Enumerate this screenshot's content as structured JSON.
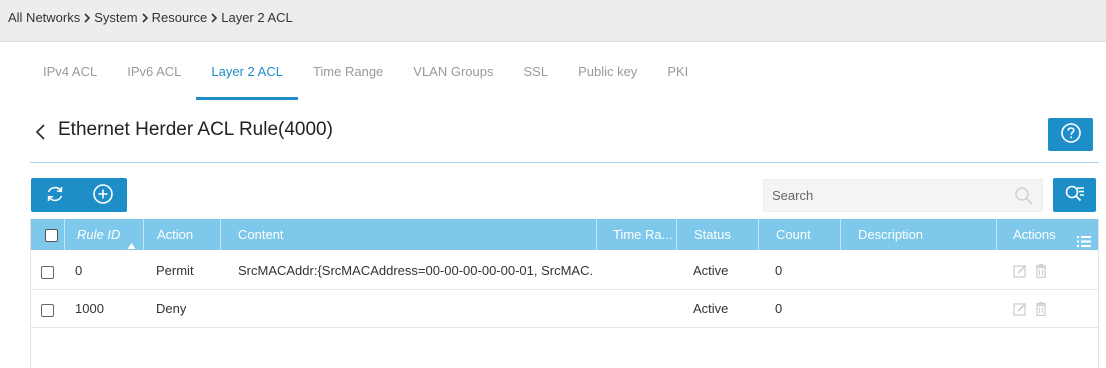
{
  "breadcrumb": [
    "All Networks",
    "System",
    "Resource",
    "Layer 2 ACL"
  ],
  "tabs": [
    {
      "label": "IPv4 ACL",
      "active": false
    },
    {
      "label": "IPv6 ACL",
      "active": false
    },
    {
      "label": "Layer 2 ACL",
      "active": true
    },
    {
      "label": "Time Range",
      "active": false
    },
    {
      "label": "VLAN Groups",
      "active": false
    },
    {
      "label": "SSL",
      "active": false
    },
    {
      "label": "Public key",
      "active": false
    },
    {
      "label": "PKI",
      "active": false
    }
  ],
  "page": {
    "title": "Ethernet Herder ACL Rule(4000)",
    "back_icon": "chevron-left-icon",
    "help_icon": "question-circle-icon"
  },
  "toolbar": {
    "refresh_icon": "refresh-icon",
    "add_icon": "plus-circle-icon"
  },
  "search": {
    "placeholder": "Search",
    "value": "",
    "search_icon": "magnifier-icon",
    "advanced_icon": "advanced-search-icon"
  },
  "table": {
    "columns": {
      "rule_id": "Rule ID",
      "action": "Action",
      "content": "Content",
      "time_range": "Time Ra...",
      "status": "Status",
      "count": "Count",
      "description": "Description",
      "actions": "Actions"
    },
    "sort": {
      "column": "rule_id",
      "direction": "ascending"
    },
    "rows": [
      {
        "rule_id": "0",
        "action": "Permit",
        "content": "SrcMACAddr:{SrcMACAddress=00-00-00-00-00-01, SrcMAC...",
        "time_range": "",
        "status": "Active",
        "count": "0",
        "description": ""
      },
      {
        "rule_id": "1000",
        "action": "Deny",
        "content": "",
        "time_range": "",
        "status": "Active",
        "count": "0",
        "description": ""
      }
    ],
    "row_action_icons": [
      "edit-icon",
      "delete-icon"
    ]
  },
  "colors": {
    "accent": "#1e8ec8",
    "table_header": "#7ec8eb",
    "breadcrumb_bar": "#ededed"
  }
}
